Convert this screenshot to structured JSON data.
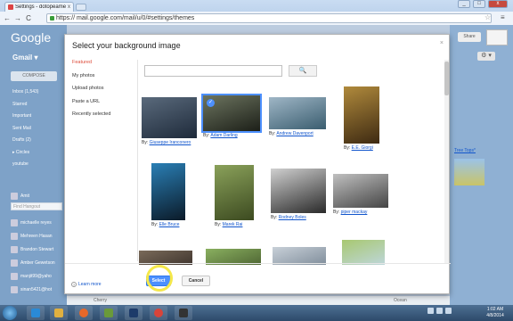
{
  "browser": {
    "tab_title": "Settings - dotopeamer@g...",
    "tab_close": "x",
    "url_https": "https://",
    "url_rest": "mail.google.com/mail/u/0/#settings/themes",
    "back": "←",
    "forward": "→",
    "reload": "C",
    "star": "☆",
    "wrench": "≡"
  },
  "gmail": {
    "logo": "Google",
    "label": "Gmail ▾",
    "compose": "COMPOSE",
    "nav": [
      "Inbox (1,543)",
      "Starred",
      "Important",
      "Sent Mail",
      "Drafts (2)",
      "▸ Circles",
      "youtube"
    ],
    "chat_user": "Amit",
    "chat_search_placeholder": "Find Hangout",
    "contacts": [
      "michaelle reyes",
      "Mehreen Hasan",
      "Brandon Stewart",
      "Amber Gewetson",
      "manjit99@yaho",
      "sinan5421@hot"
    ],
    "share": "Share",
    "settings_icon": "⚙ ▾",
    "tree_tops": "Tree Tops*",
    "bottom_left": "Cherry",
    "bottom_right": "Ocean"
  },
  "dialog": {
    "title": "Select your background image",
    "close": "×",
    "sidebar": [
      {
        "label": "Featured",
        "active": true
      },
      {
        "label": "My photos",
        "active": false
      },
      {
        "label": "Upload photos",
        "active": false
      },
      {
        "label": "Paste a URL",
        "active": false
      },
      {
        "label": "Recently selected",
        "active": false
      }
    ],
    "search_button": "🔍",
    "learn_more": "Learn more",
    "select_button": "Select",
    "cancel_button": "Cancel",
    "photos": [
      {
        "by": "By:",
        "author": "Giuseppe Iranconero",
        "colors": [
          "#5a6a7c",
          "#1e2a3a"
        ],
        "selected": false
      },
      {
        "by": "By:",
        "author": "Adam Darling",
        "colors": [
          "#6d7560",
          "#1c1f18"
        ],
        "selected": true
      },
      {
        "by": "By:",
        "author": "Andrew Davenport",
        "colors": [
          "#9fb6c6",
          "#3a5d6f"
        ],
        "selected": false
      },
      {
        "by": "By:",
        "author": "E.E. Giorgi",
        "colors": [
          "#b08a3c",
          "#3e2a12"
        ],
        "selected": false
      },
      {
        "by": "By:",
        "author": "Elle Bruce",
        "colors": [
          "#2a7fb5",
          "#0b1a28"
        ],
        "selected": false
      },
      {
        "by": "By:",
        "author": "Marek Rai",
        "colors": [
          "#8aa15a",
          "#3c4a20"
        ],
        "selected": false
      },
      {
        "by": "By:",
        "author": "Rodney Boles",
        "colors": [
          "#d0d0d0",
          "#2a2a2a"
        ],
        "selected": false
      },
      {
        "by": "By:",
        "author": "piper mackay",
        "colors": [
          "#c0c0c0",
          "#444444"
        ],
        "selected": false
      },
      {
        "by": "",
        "author": "",
        "colors": [
          "#7a6a5a",
          "#3a302a"
        ],
        "selected": false
      },
      {
        "by": "",
        "author": "",
        "colors": [
          "#8ab060",
          "#4a6030"
        ],
        "selected": false
      },
      {
        "by": "",
        "author": "",
        "colors": [
          "#c8d0d8",
          "#7a8896"
        ],
        "selected": false
      },
      {
        "by": "",
        "author": "",
        "colors": [
          "#a8c870",
          "#c0d8e8"
        ],
        "selected": false
      }
    ]
  },
  "taskbar": {
    "time": "1:02 AM",
    "date": "4/8/2014"
  }
}
